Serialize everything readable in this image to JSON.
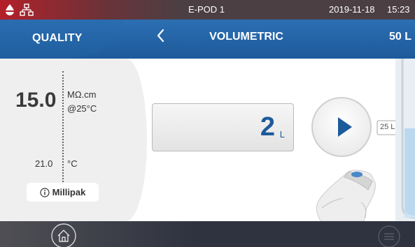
{
  "status_bar": {
    "device_name": "E-POD 1",
    "date": "2019-11-18",
    "time": "15:23",
    "icons": [
      "alert-drop-icon",
      "network-icon"
    ]
  },
  "header": {
    "quality_tab_label": "QUALITY",
    "title": "VOLUMETRIC",
    "volume_preset": "50 L"
  },
  "quality_panel": {
    "resistivity_value": "15.0",
    "resistivity_unit": "MΩ.cm",
    "resistivity_ref_temp": "@25°C",
    "temperature_value": "21.0",
    "temperature_unit": "°C",
    "filter_label": "Millipak",
    "filter_info_icon": "info-icon"
  },
  "dispense": {
    "volume_value": "2",
    "volume_unit": "L",
    "preset_label": "25 L",
    "play_icon": "play-icon"
  },
  "bottom_bar": {
    "icons": [
      "home-icon",
      "menu-icon"
    ]
  },
  "colors": {
    "header_blue": "#1d5a9b",
    "status_red": "#b3202a",
    "bar_dark": "#2f3340",
    "panel_gray": "#efefef"
  }
}
